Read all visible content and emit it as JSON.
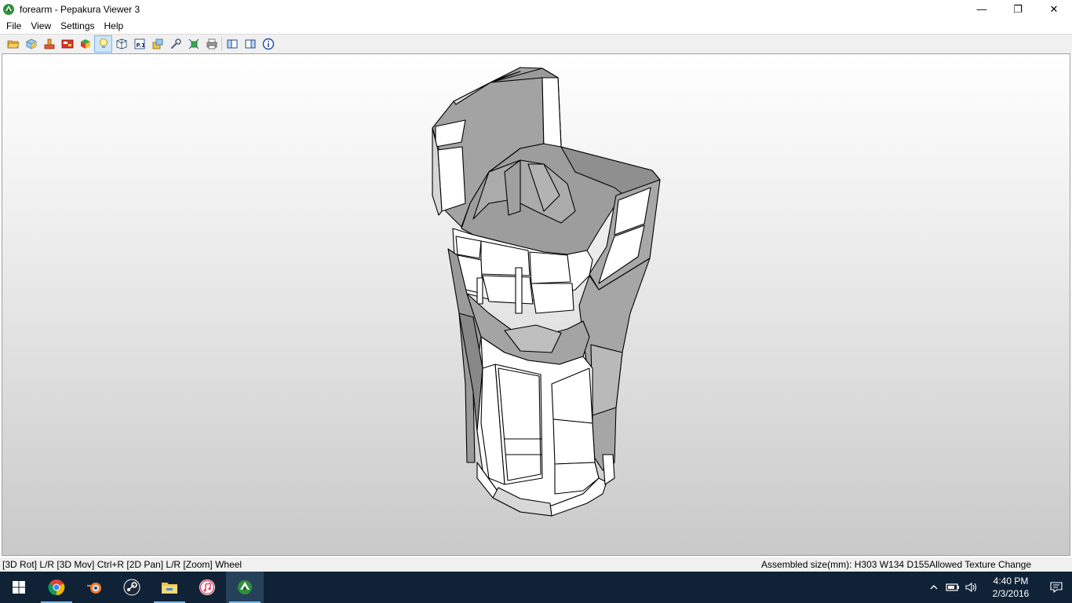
{
  "window": {
    "title": "forearm - Pepakura Viewer 3",
    "minimize_glyph": "—",
    "maximize_glyph": "❐",
    "close_glyph": "✕",
    "icon": "pepakura-app-icon"
  },
  "menu": {
    "items": [
      "File",
      "View",
      "Settings",
      "Help"
    ]
  },
  "toolbar": {
    "icons": [
      "open-folder-icon",
      "3d-model-icon",
      "unfold-icon",
      "texture-icon",
      "color-cube-icon",
      "lightbulb-icon",
      "edge-view-icon",
      "page-number-icon",
      "layout-icon",
      "wrench-icon",
      "transfer-icon",
      "print-icon",
      "single-pane-icon",
      "dual-pane-icon",
      "info-icon"
    ],
    "active_index": 5
  },
  "status": {
    "left": "[3D Rot] L/R [3D Mov] Ctrl+R [2D Pan] L/R [Zoom] Wheel",
    "right": "Assembled size(mm): H303 W134 D155Allowed Texture Change"
  },
  "taskbar": {
    "apps": [
      "windows-start-icon",
      "chrome-icon",
      "blender-icon",
      "steam-icon",
      "file-explorer-icon",
      "itunes-icon",
      "pepakura-icon"
    ],
    "clock_time": "4:40 PM",
    "clock_date": "2/3/2016"
  },
  "colors": {
    "viewport_top": "#ffffff",
    "viewport_bottom": "#c9c9c9",
    "model_face_light": "#ffffff",
    "model_face_dark": "#a3a3a3",
    "taskbar": "#0f2236"
  }
}
